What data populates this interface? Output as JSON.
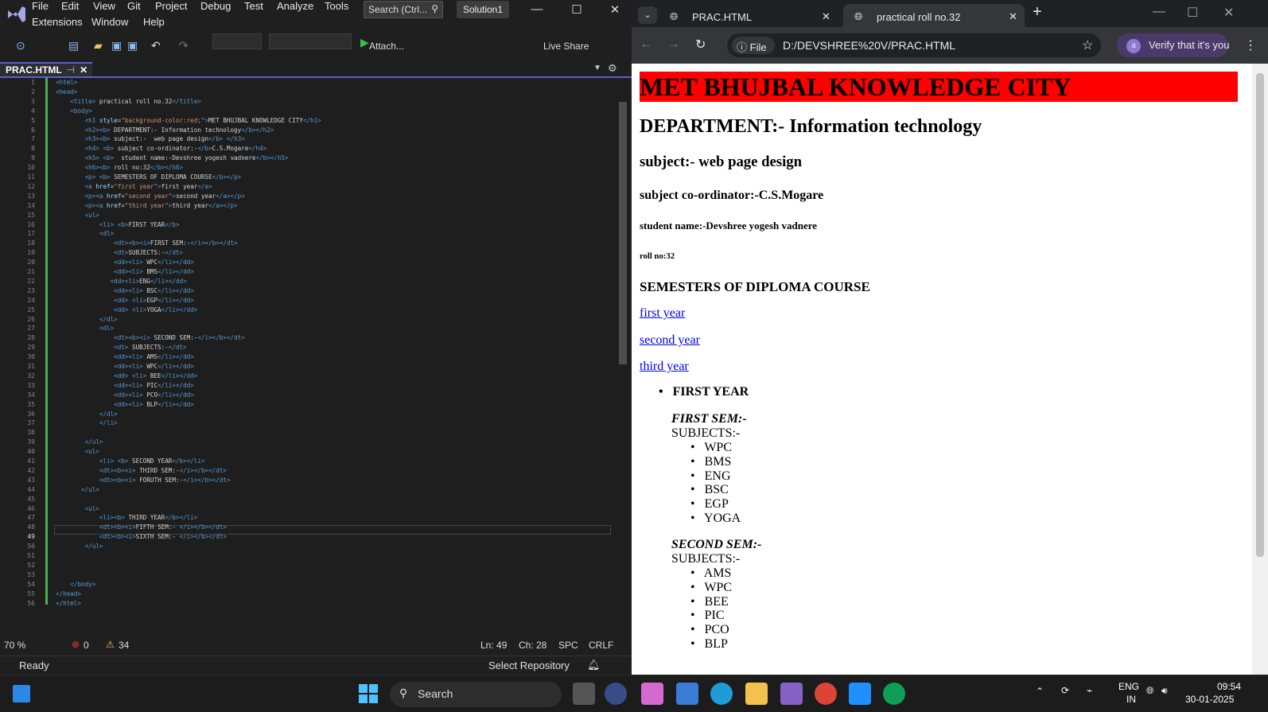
{
  "vs": {
    "menu": [
      "File",
      "Edit",
      "View",
      "Git",
      "Project",
      "Debug",
      "Test",
      "Analyze",
      "Tools",
      "Extensions",
      "Window",
      "Help"
    ],
    "search_placeholder": "Search (Ctrl...",
    "solution": "Solution1",
    "attach_label": "Attach...",
    "liveshare_label": "Live Share",
    "tab_label": "PRAC.HTML",
    "code_lines": [
      "<html>",
      "<head>",
      "    <title> practical roll no.32</title>",
      "    <body>",
      "        <h1 style=\"background-color:red;\">MET BHUJBAL KNOWLEDGE CITY</h1>",
      "        <h2><b> DEPARTMENT:- Information technology</b></h2>",
      "        <h3><b> subject:-  web page design</b> </h3>",
      "        <h4> <b> subject co-ordinator:-</b>C.S.Mogare</h4>",
      "        <h5> <b>  student name:-Devshree yogesh vadnere</b></h5>",
      "        <h6><b> roll no:32</b></h6>",
      "        <p> <b> SEMESTERS OF DIPLOMA COURSE</b></p>",
      "        <a href=\"first year\">first year</a>",
      "        <p><a href=\"second year\">second year</a></p>",
      "        <p><a href=\"third year\">third year</a></p>",
      "        <ul>",
      "            <li> <b>FIRST YEAR</b>",
      "            <dl>",
      "                <dt><b><i>FIRST SEM:-</i></b></dt>",
      "                <dt>SUBJECTS:-</dt>",
      "                <dd><li> WPC</li></dd>",
      "                <dd><li> BMS</li></dd>",
      "               <dd><li>ENG</li></dd>",
      "                <dd><li> BSC</li></dd>",
      "                <dd> <li>EGP</li></dd>",
      "                <dd> <li>YOGA</li></dd>",
      "            </dl>",
      "            <dl>",
      "                <dt><b><i> SECOND SEM:-</i></b></dt>",
      "                <dt> SUBJECTS:-</dt>",
      "                <dd><li> AMS</li></dd>",
      "                <dd><li> WPC</li></dd>",
      "                <dd> <li> BEE</li></dd>",
      "                <dd><li> PIC</li></dd>",
      "                <dd><li> PCO</li></dd>",
      "                <dd><li> BLP</li></dd>",
      "            </dl>",
      "            </li>",
      "",
      "        </ul>",
      "        <ul>",
      "            <li> <b> SECOND YEAR</b></li>",
      "            <dt><b><i> THIRD SEM:-</i></b></dt>",
      "            <dt><b><i> FORUTH SEM:-</i></b></dt>",
      "       </ul>",
      "",
      "        <ul>",
      "            <li><b> THIRD YEAR</b></li>",
      "            <dt><b><i>FIFTH SEM:- </i></b></dt>",
      "            <dt><b><i>SIXTH SEM:- </i></b></dt>",
      "        </ul>",
      "",
      "",
      "",
      "    </body>",
      "</head>",
      "</html>"
    ],
    "editor_status": {
      "zoom": "70 %",
      "errors": "0",
      "warnings": "34",
      "ln": "Ln: 49",
      "ch": "Ch: 28",
      "spc": "SPC",
      "crlf": "CRLF"
    },
    "status": {
      "ready": "Ready",
      "repo": "Select Repository"
    }
  },
  "browser": {
    "tab1": "PRAC.HTML",
    "tab2": "practical roll no.32",
    "file_chip": "File",
    "url": "D:/DEVSHREE%20V/PRAC.HTML",
    "verify": "Verify that it's you",
    "page": {
      "h1": "MET BHUJBAL KNOWLEDGE CITY",
      "h2": "DEPARTMENT:- Information technology",
      "h3": "subject:- web page design",
      "h4": "subject co-ordinator:-C.S.Mogare",
      "h5": "student name:-Devshree yogesh vadnere",
      "h6": "roll no:32",
      "p": "SEMESTERS OF DIPLOMA COURSE",
      "link1": "first year",
      "link2": "second year",
      "link3": "third year",
      "first_year": "FIRST YEAR",
      "sem1": "FIRST SEM:-",
      "subjects": "SUBJECTS:-",
      "sem1_items": [
        "WPC",
        "BMS",
        "ENG",
        "BSC",
        "EGP",
        "YOGA"
      ],
      "sem2": "SECOND SEM:-",
      "sem2_items": [
        "AMS",
        "WPC",
        "BEE",
        "PIC",
        "PCO",
        "BLP"
      ]
    }
  },
  "taskbar": {
    "search": "Search",
    "lang1": "ENG",
    "lang2": "IN",
    "time": "09:54",
    "date": "30-01-2025"
  }
}
